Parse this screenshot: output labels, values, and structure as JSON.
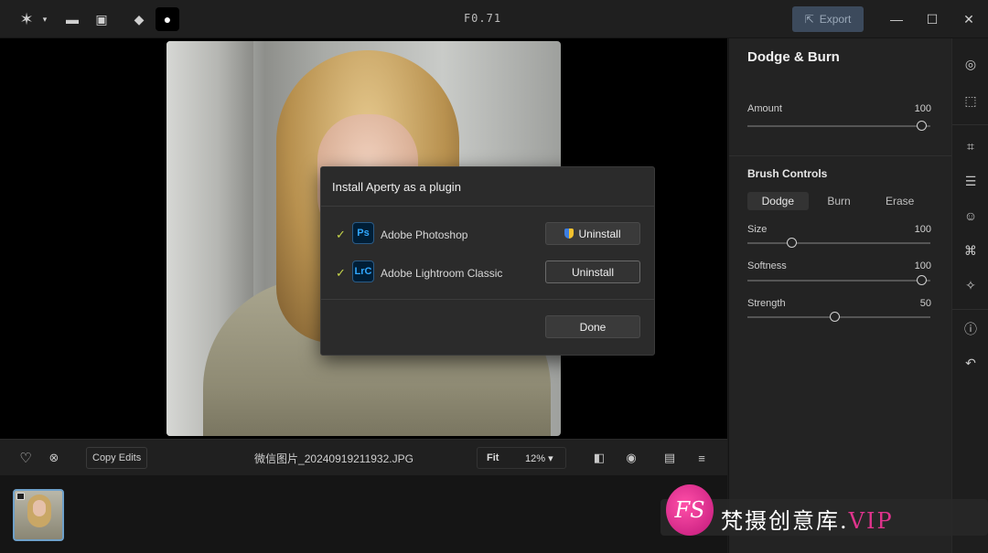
{
  "app": {
    "title": "F0.71"
  },
  "toolbar": {
    "export_label": "Export"
  },
  "image": {
    "file_name": "微信图片_20240919211932.JPG"
  },
  "bottom": {
    "copy_edits": "Copy Edits",
    "fit_label": "Fit",
    "zoom_label": "12%"
  },
  "panel": {
    "title": "Dodge & Burn",
    "amount": {
      "label": "Amount",
      "value": "100",
      "fraction": 1.0
    },
    "brush_title": "Brush Controls",
    "modes": [
      "Dodge",
      "Burn",
      "Erase"
    ],
    "active_mode": "Dodge",
    "size": {
      "label": "Size",
      "value": "100",
      "fraction": 0.25
    },
    "softness": {
      "label": "Softness",
      "value": "100",
      "fraction": 1.0
    },
    "strength": {
      "label": "Strength",
      "value": "50",
      "fraction": 0.5
    }
  },
  "modal": {
    "title": "Install Aperty as a plugin",
    "plugins": [
      {
        "badge": "Ps",
        "name": "Adobe Photoshop",
        "action": "Uninstall"
      },
      {
        "badge": "LrC",
        "name": "Adobe Lightroom Classic",
        "action": "Uninstall"
      }
    ],
    "done_label": "Done"
  },
  "watermark": {
    "logo": "FS",
    "text": "梵摄创意库.",
    "vip": "VIP"
  },
  "colors": {
    "accent": "#6ea0c9",
    "check": "#c7d64a",
    "export_bg": "#3c4a5c"
  }
}
